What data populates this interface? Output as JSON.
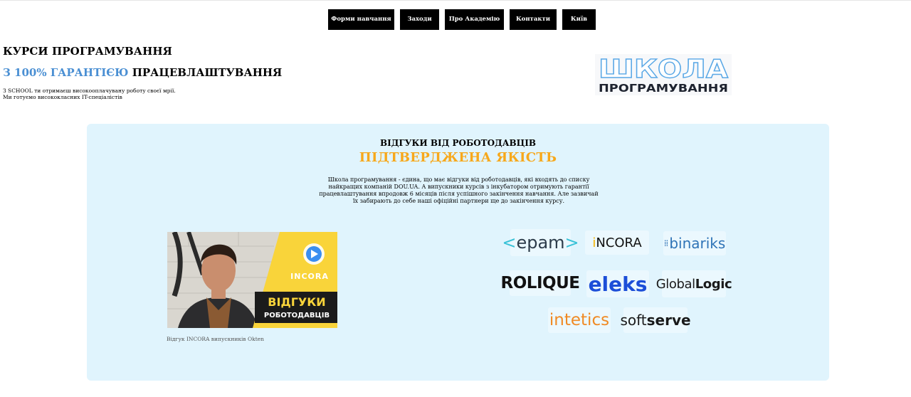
{
  "nav": {
    "items": [
      "Форми навчання",
      "Заходи",
      "Про Академію",
      "Контакти",
      "Київ"
    ]
  },
  "hero": {
    "title_line1": "КУРСИ ПРОГРАМУВАННЯ",
    "title_line2_accent": "З 100% ГАРАНТІЄЮ",
    "title_line2_rest": " ПРАЦЕВЛАШТУВАННЯ",
    "desc_line1": "З SCHOOL ти отримаєш високооплачувану роботу своєї мрії.",
    "desc_line2": "Ми готуємо висококласних IT-спеціалістів",
    "accent_color": "#4a8fd3"
  },
  "school_logo": {
    "word1": "ШКОЛА",
    "word2": "ПРОГРАМУВАННЯ"
  },
  "reviews": {
    "kicker": "ВІДГУКИ ВІД РОБОТОДАВЦІВ",
    "title": "ПІДТВЕРДЖЕНА ЯКІСТЬ",
    "title_color": "#f7a81b",
    "text": "Школа програмування - єдина, що має відгуки від роботодавців, які входять до списку найкращих компаній DOU.UA. А випускники курсів з інкубатором отримують гарантії працевлаштування впродовж 6 місяців після успішного закінчення навчання. Але зазвичай їх забирають до себе наші офіційні партнери ще до закінчення курсу.",
    "panel_color": "#e0f4fd"
  },
  "video": {
    "brand": "INCORA",
    "banner_line1": "ВІДГУКИ",
    "banner_line2": "РОБОТОДАВЦІВ",
    "caption": "Відгук INCORA випускників Okten",
    "banner_color": "#f9d43a"
  },
  "partners": {
    "epam": "epam",
    "incora": "NCORA",
    "binariks": "binariks",
    "rolique": "ROLIQUE",
    "eleks": "eleks",
    "globallogic_a": "Global",
    "globallogic_b": "Logic",
    "intetics": "intetics",
    "softserve_a": "soft",
    "softserve_b": "serve"
  }
}
